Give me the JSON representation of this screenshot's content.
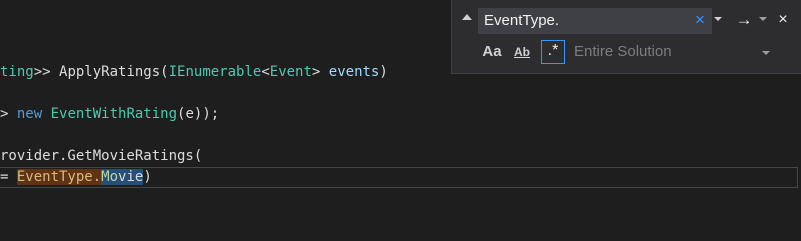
{
  "editor": {
    "line1": {
      "part1": "ting",
      "part2": ">> ",
      "part3": "ApplyRatings",
      "part4": "(",
      "part5": "IEnumerable",
      "part6": "<",
      "part7": "Event",
      "part8": "> ",
      "part9": "events",
      "part10": ")"
    },
    "line2": {
      "part1": "> ",
      "part2": "new",
      "part3": " ",
      "part4": "EventWithRating",
      "part5": "(e));"
    },
    "line3": {
      "part1": "rovider.GetMovieRatings("
    },
    "line4": {
      "part1": "= ",
      "part2": "EventType.",
      "part3": "Mo",
      "part4": "vie",
      "part5": ")"
    }
  },
  "find": {
    "query": "EventType.",
    "clear_icon": "×",
    "next_icon": "→",
    "close_icon": "×",
    "match_case_label": "Aa",
    "whole_word_label": "Ab",
    "regex_label": ".*",
    "scope": "Entire Solution"
  },
  "colors": {
    "background": "#1e1e1e",
    "type": "#4ec9b0",
    "keyword": "#569cd6",
    "identifier": "#9cdcfe",
    "find_highlight": "#613315",
    "selection": "#264f78",
    "accent": "#3794ff"
  }
}
